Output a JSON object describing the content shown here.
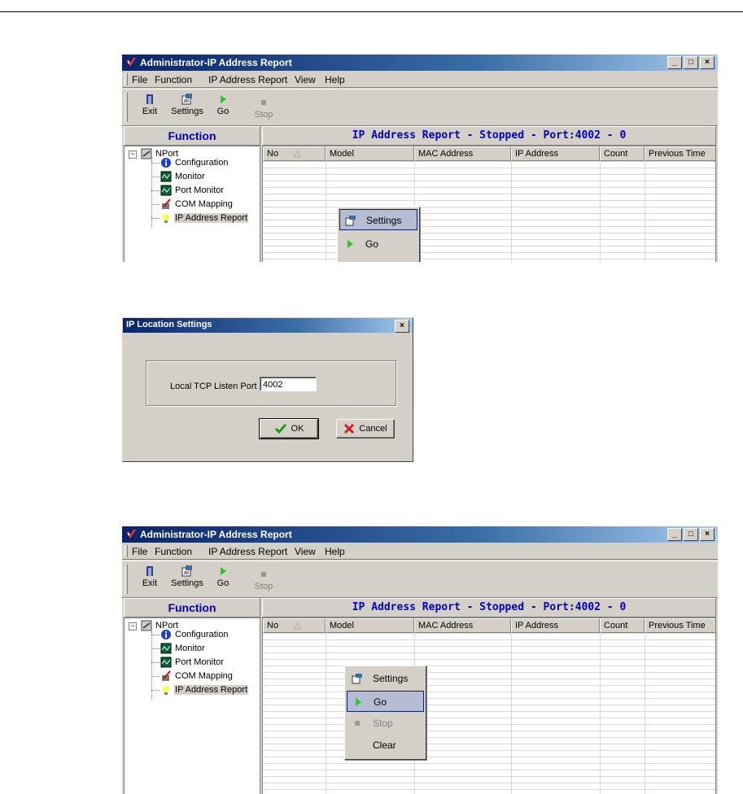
{
  "window": {
    "title": "Administrator-IP Address Report",
    "menu": [
      "File",
      "Function",
      "IP Address Report",
      "View",
      "Help"
    ],
    "menu_accel": [
      "F",
      "F",
      "I",
      "V",
      "H"
    ],
    "toolbar": [
      {
        "label": "Exit",
        "icon": "exit-icon",
        "enabled": true
      },
      {
        "label": "Settings",
        "icon": "settings-icon",
        "enabled": true
      },
      {
        "label": "Go",
        "icon": "go-icon",
        "enabled": true
      },
      {
        "label": "Stop",
        "icon": "stop-icon",
        "enabled": false
      }
    ],
    "function_header": "Function",
    "report_header": "IP Address Report - Stopped - Port:4002 - 0",
    "tree": {
      "root": "NPort",
      "items": [
        "Configuration",
        "Monitor",
        "Port Monitor",
        "COM Mapping",
        "IP Address Report"
      ],
      "selected": "IP Address Report"
    },
    "columns": [
      "No",
      "Model",
      "MAC Address",
      "IP Address",
      "Count",
      "Previous Time"
    ]
  },
  "context_menu_1": {
    "items": [
      {
        "label": "Settings",
        "icon": "settings-icon",
        "highlighted": true,
        "enabled": true
      },
      {
        "label": "Go",
        "icon": "go-icon",
        "highlighted": false,
        "enabled": true
      }
    ]
  },
  "dialog": {
    "title": "IP Location Settings",
    "close": "×",
    "port_label": "Local TCP Listen Port",
    "port_value": "4002",
    "ok": "OK",
    "cancel": "Cancel"
  },
  "context_menu_2": {
    "items": [
      {
        "label": "Settings",
        "icon": "settings-icon",
        "highlighted": false,
        "enabled": true
      },
      {
        "label": "Go",
        "icon": "go-icon",
        "highlighted": true,
        "enabled": true
      },
      {
        "label": "Stop",
        "icon": "stop-icon",
        "highlighted": false,
        "enabled": false
      },
      {
        "label": "Clear",
        "icon": "",
        "highlighted": false,
        "enabled": true
      }
    ]
  },
  "colors": {
    "title_start": "#0a246a",
    "title_end": "#a6caf0",
    "header_text": "#0000c0",
    "face": "#d4d0c8"
  }
}
